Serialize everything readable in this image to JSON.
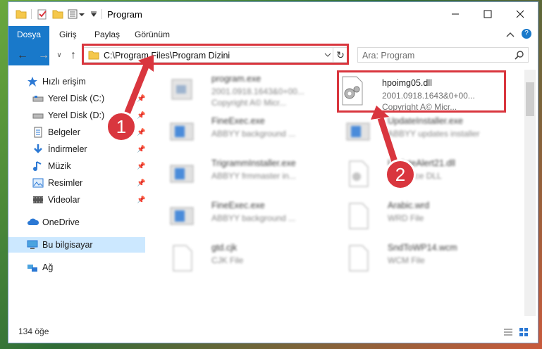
{
  "window": {
    "title": "Program"
  },
  "ribbon": {
    "tabs": [
      "Dosya",
      "Giriş",
      "Paylaş",
      "Görünüm"
    ]
  },
  "address": {
    "path": "C:\\Program Files\\Program Dizini"
  },
  "search": {
    "placeholder": "Ara: Program"
  },
  "sidebar": {
    "items": [
      {
        "label": "Hızlı erişim",
        "icon": "star-icon"
      },
      {
        "label": "Yerel Disk (C:)",
        "icon": "drive-icon"
      },
      {
        "label": "Yerel Disk (D:)",
        "icon": "drive-icon"
      },
      {
        "label": "Belgeler",
        "icon": "documents-icon"
      },
      {
        "label": "İndirmeler",
        "icon": "download-icon"
      },
      {
        "label": "Müzik",
        "icon": "music-icon"
      },
      {
        "label": "Resimler",
        "icon": "pictures-icon"
      },
      {
        "label": "Videolar",
        "icon": "videos-icon"
      },
      {
        "label": "OneDrive",
        "icon": "cloud-icon"
      },
      {
        "label": "Bu bilgisayar",
        "icon": "computer-icon"
      },
      {
        "label": "Ağ",
        "icon": "network-icon"
      }
    ]
  },
  "files": [
    {
      "name": "program.exe",
      "line1": "2001.0918.1643&0+00...",
      "line2": "Copyright A© Micr..."
    },
    {
      "name": "hpoimg05.dll",
      "line1": "2001.0918.1643&0+00...",
      "line2": "Copyright A© Micr..."
    },
    {
      "name": "FineExec.exe",
      "line1": "ABBYY background ..."
    },
    {
      "name": "UpdateInstaller.exe",
      "line1": "ABBYY updates installer"
    },
    {
      "name": "TrigrammInstaller.exe",
      "line1": "ABBYY frmmaster in..."
    },
    {
      "name": "UpdateAlert21.dll",
      "line1": "Resource DLL"
    },
    {
      "name": "FineExec.exe",
      "line1": "ABBYY background ..."
    },
    {
      "name": "Arabic.wrd",
      "line1": "WRD File"
    },
    {
      "name": "gtd.cjk",
      "line1": "CJK File"
    },
    {
      "name": "SndToWP14.wcm",
      "line1": "WCM File"
    }
  ],
  "status": {
    "count": "134 öğe"
  },
  "callouts": [
    "1",
    "2"
  ]
}
